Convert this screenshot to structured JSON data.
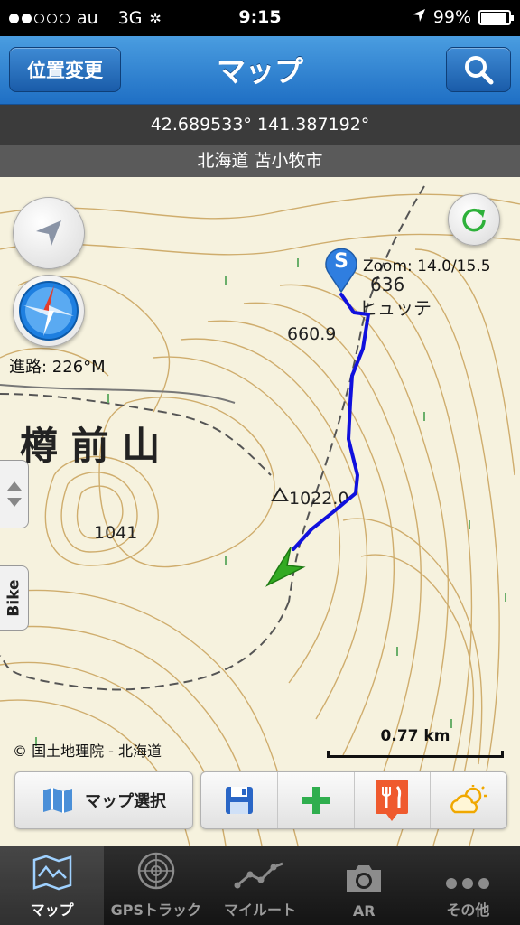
{
  "status_bar": {
    "carrier": "au",
    "network": "3G",
    "time": "9:15",
    "battery": "99%"
  },
  "nav": {
    "left_button": "位置変更",
    "title": "マップ",
    "right_icon": "search-icon"
  },
  "location": {
    "coordinates": "42.689533° 141.387192°",
    "place_name": "北海道 苫小牧市"
  },
  "map": {
    "heading": "進路: 226°M",
    "zoom": "Zoom: 14.0/15.5",
    "side_tab_label": "Bike",
    "copyright": "© 国土地理院 - 北海道",
    "scale": "0.77 km",
    "labels": {
      "mountain": "樽 前 山",
      "peak_1041": "1041",
      "peak_1022": "1022.0",
      "point_660": "660.9",
      "point_636": "636",
      "hut": "ヒュッテ"
    },
    "start_marker": "S",
    "track_color": "#1010dd",
    "position_arrow_color": "#33aa22"
  },
  "toolbar": {
    "map_select": "マップ選択",
    "icons": [
      "save-icon",
      "add-icon",
      "restaurant-icon",
      "weather-icon"
    ]
  },
  "tabs": [
    {
      "label": "マップ",
      "icon": "map-icon",
      "active": true
    },
    {
      "label": "GPSトラック",
      "icon": "radar-icon",
      "active": false
    },
    {
      "label": "マイルート",
      "icon": "route-icon",
      "active": false
    },
    {
      "label": "AR",
      "icon": "camera-icon",
      "active": false
    },
    {
      "label": "その他",
      "icon": "more-icon",
      "active": false
    }
  ]
}
